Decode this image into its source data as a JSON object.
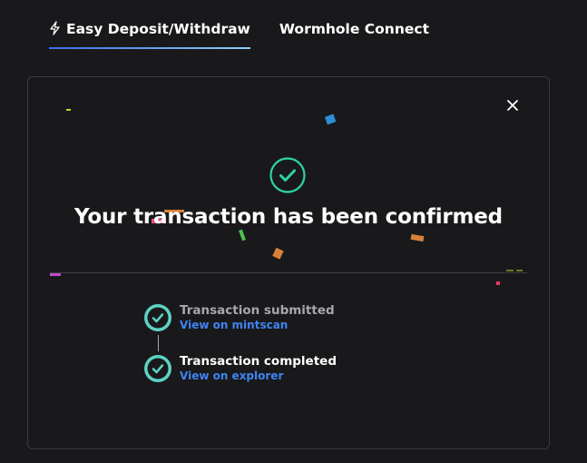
{
  "tabs": [
    {
      "label": "Easy Deposit/Withdraw",
      "icon": "bolt-icon",
      "active": true
    },
    {
      "label": "Wormhole Connect",
      "active": false
    }
  ],
  "modal": {
    "close_icon": "close-icon",
    "success_icon": "check-circle-icon",
    "title": "Your transaction has been confirmed",
    "steps": [
      {
        "label": "Transaction submitted",
        "link": "View on mintscan",
        "icon": "check-circle-icon",
        "muted": true
      },
      {
        "label": "Transaction completed",
        "link": "View on explorer",
        "icon": "check-circle-icon",
        "muted": false
      }
    ]
  },
  "colors": {
    "background": "#19191c",
    "accent_green": "#2ed3a1",
    "step_check": "#5dd3c4",
    "link_blue": "#3f84f2",
    "tab_underline": [
      "#3b6ee8",
      "#8fd0f2"
    ]
  }
}
